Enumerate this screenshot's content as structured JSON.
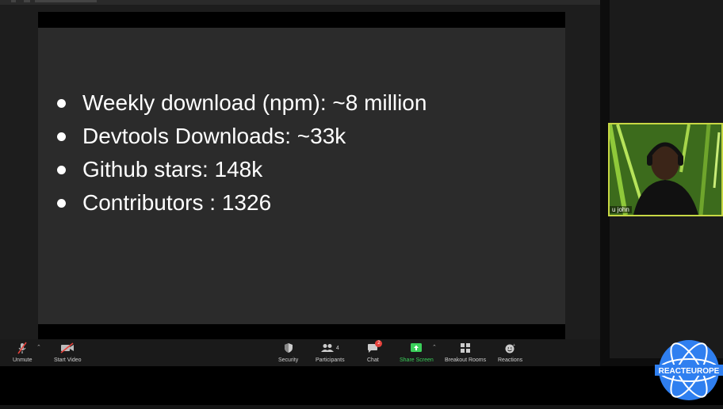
{
  "slide": {
    "bullets": [
      "Weekly download (npm): ~8 million",
      "Devtools Downloads: ~33k",
      "Github stars: 148k",
      "Contributors : 1326"
    ]
  },
  "toolbar": {
    "unmute": "Unmute",
    "start_video": "Start Video",
    "security": "Security",
    "participants": "Participants",
    "participants_count": "4",
    "chat": "Chat",
    "chat_badge": "2",
    "share_screen": "Share Screen",
    "breakout_rooms": "Breakout Rooms",
    "reactions": "Reactions"
  },
  "video": {
    "name": "u john"
  },
  "logo": {
    "text": "REACTEUROPE"
  },
  "colors": {
    "share_green": "#3ad05a",
    "badge_red": "#e5413b",
    "tile_border": "#c8d845",
    "logo_blue": "#2f7ff0"
  }
}
